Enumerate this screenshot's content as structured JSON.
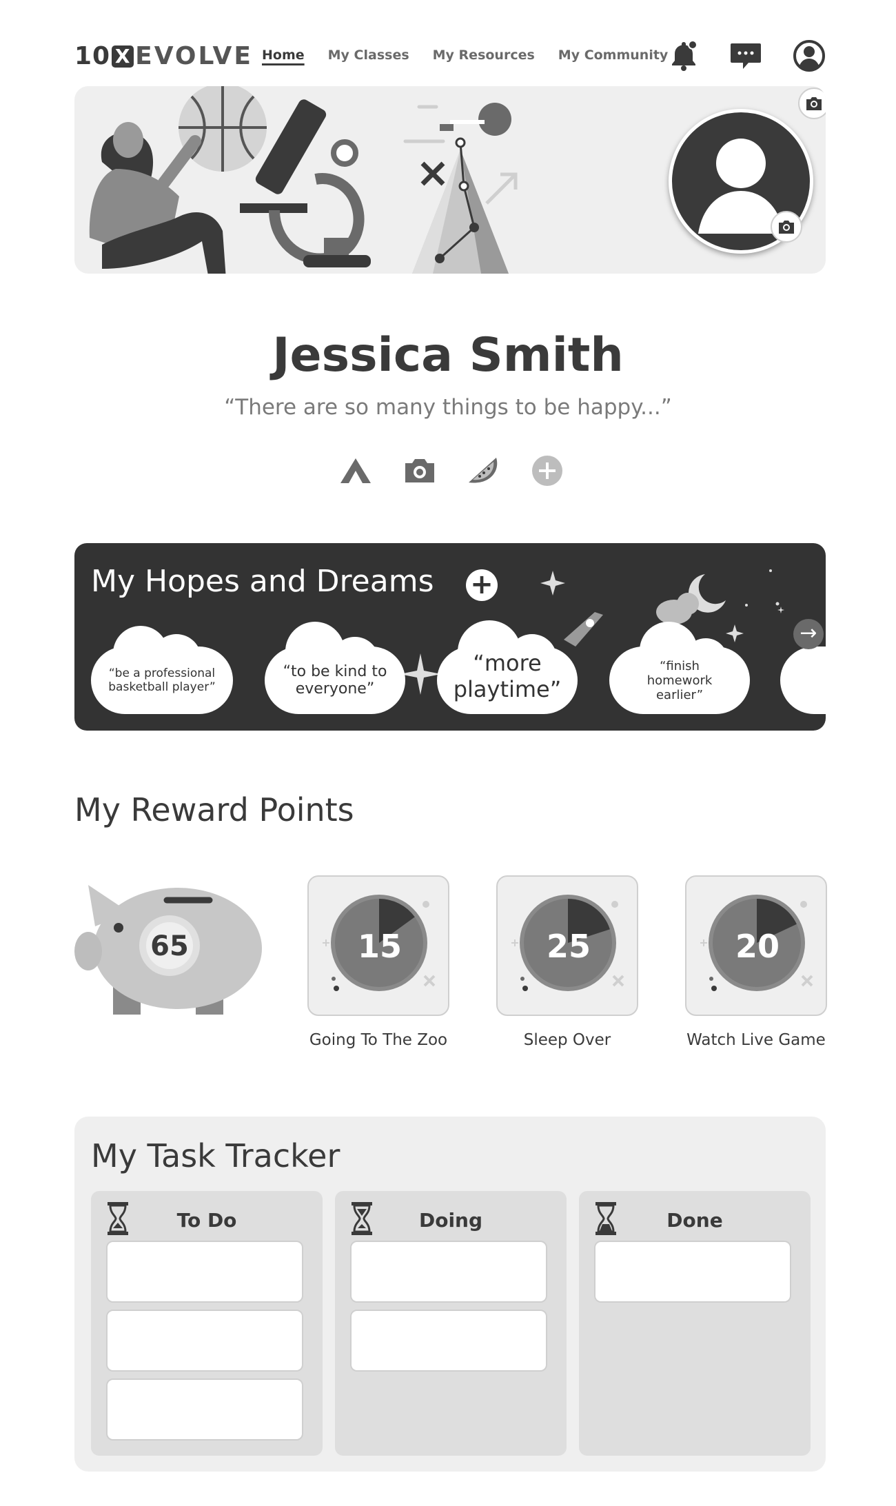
{
  "nav": {
    "logo_num": "10",
    "logo_x": "X",
    "logo_word": "EVOLVE",
    "links": [
      "Home",
      "My Classes",
      "My Resources",
      "My Community"
    ]
  },
  "profile": {
    "name": "Jessica Smith",
    "quote": "“There are so many things to be happy...”"
  },
  "hopes": {
    "title": "My Hopes and Dreams",
    "add": "+",
    "next": "→",
    "dreams": [
      "“be a professional basketball player”",
      "“to be kind to everyone”",
      "“more playtime”",
      "“finish homework earlier”"
    ]
  },
  "rewards": {
    "title": "My Reward Points",
    "total": "65",
    "items": [
      {
        "points": "15",
        "label": "Going To The Zoo",
        "progress": 0.15
      },
      {
        "points": "25",
        "label": "Sleep Over",
        "progress": 0.2
      },
      {
        "points": "20",
        "label": "Watch Live Game",
        "progress": 0.18
      }
    ]
  },
  "tasks": {
    "title": "My Task Tracker",
    "columns": [
      {
        "title": "To Do",
        "count": 3
      },
      {
        "title": "Doing",
        "count": 2
      },
      {
        "title": "Done",
        "count": 1
      }
    ]
  },
  "colors": {
    "dark": "#333333",
    "panel": "#efefef",
    "column": "#dedede",
    "accent_gray": "#6a6a6a"
  }
}
